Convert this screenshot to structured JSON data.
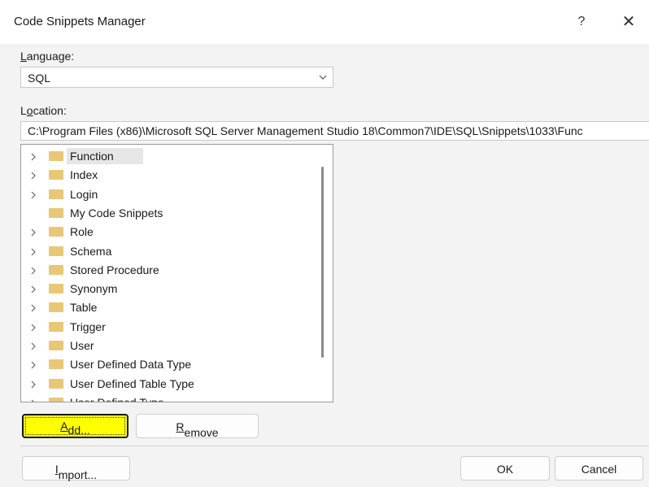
{
  "dialog": {
    "title": "Code Snippets Manager",
    "help_label": "?",
    "close_label": "✕"
  },
  "language": {
    "label_access": "L",
    "label_rest": "anguage:",
    "value": "SQL"
  },
  "location": {
    "label_pre": "L",
    "label_access": "o",
    "label_rest": "cation:",
    "path": "C:\\Program Files (x86)\\Microsoft SQL Server Management Studio 18\\Common7\\IDE\\SQL\\Snippets\\1033\\Func"
  },
  "tree": {
    "items": [
      {
        "label": "Function",
        "expandable": true,
        "selected": true
      },
      {
        "label": "Index",
        "expandable": true
      },
      {
        "label": "Login",
        "expandable": true
      },
      {
        "label": "My Code Snippets",
        "expandable": false
      },
      {
        "label": "Role",
        "expandable": true
      },
      {
        "label": "Schema",
        "expandable": true
      },
      {
        "label": "Stored Procedure",
        "expandable": true
      },
      {
        "label": "Synonym",
        "expandable": true
      },
      {
        "label": "Table",
        "expandable": true
      },
      {
        "label": "Trigger",
        "expandable": true
      },
      {
        "label": "User",
        "expandable": true
      },
      {
        "label": "User Defined Data Type",
        "expandable": true
      },
      {
        "label": "User Defined Table Type",
        "expandable": true
      },
      {
        "label": "User Defined Type",
        "expandable": true
      }
    ],
    "folder_icon": "folder-icon",
    "folder_color": "#e8c777"
  },
  "buttons": {
    "add_access": "A",
    "add_rest": "dd...",
    "remove_access": "R",
    "remove_rest": "emove",
    "import_access": "I",
    "import_rest": "mport...",
    "ok": "OK",
    "cancel": "Cancel"
  },
  "colors": {
    "highlight": "#ffff00"
  }
}
